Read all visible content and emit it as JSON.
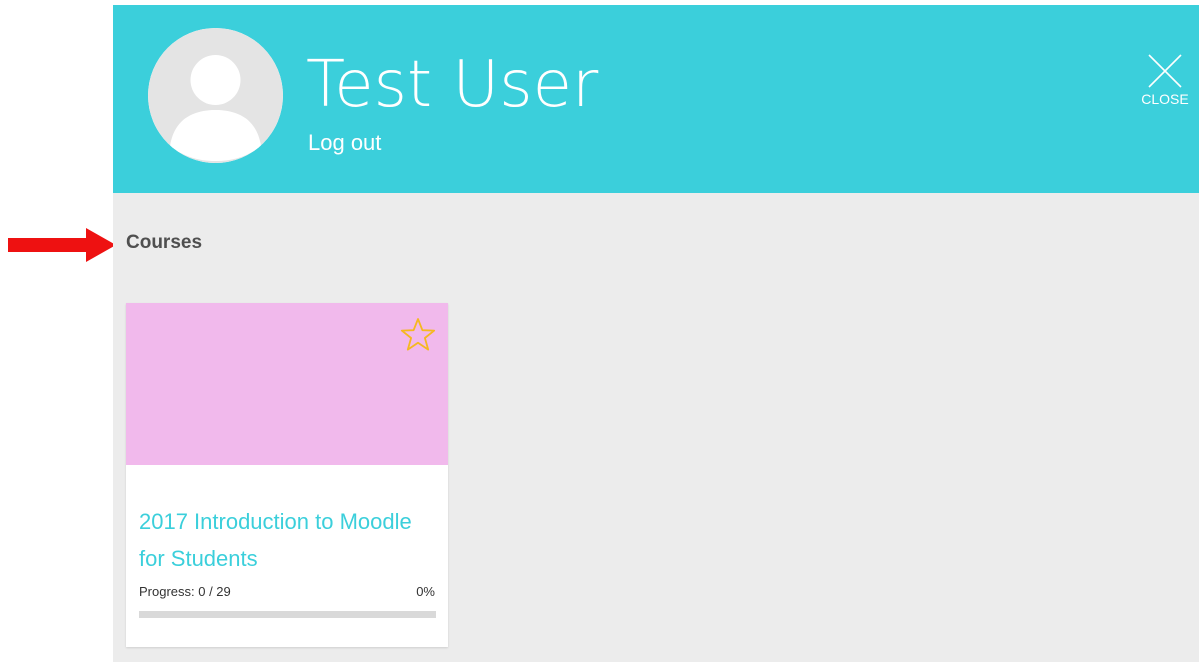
{
  "colors": {
    "header_bg": "#3bcfdb",
    "panel_bg": "#ececec",
    "course_image": "#f1b9ec",
    "accent": "#3bcfdb",
    "star": "#f5b820",
    "annotation_arrow": "#ee1111"
  },
  "header": {
    "user_name": "Test User",
    "logout_label": "Log out",
    "close_label": "CLOSE",
    "avatar_icon": "user-avatar-icon",
    "close_icon": "close-icon"
  },
  "courses": {
    "section_title": "Courses",
    "items": [
      {
        "title": "2017 Introduction to Moodle for Students",
        "progress_label": "Progress: 0 / 29",
        "progress_percent_label": "0%",
        "progress_fraction": 0,
        "favourite_icon": "star-icon",
        "favourite": false
      }
    ]
  },
  "annotation": {
    "arrow_icon": "red-arrow-icon"
  }
}
